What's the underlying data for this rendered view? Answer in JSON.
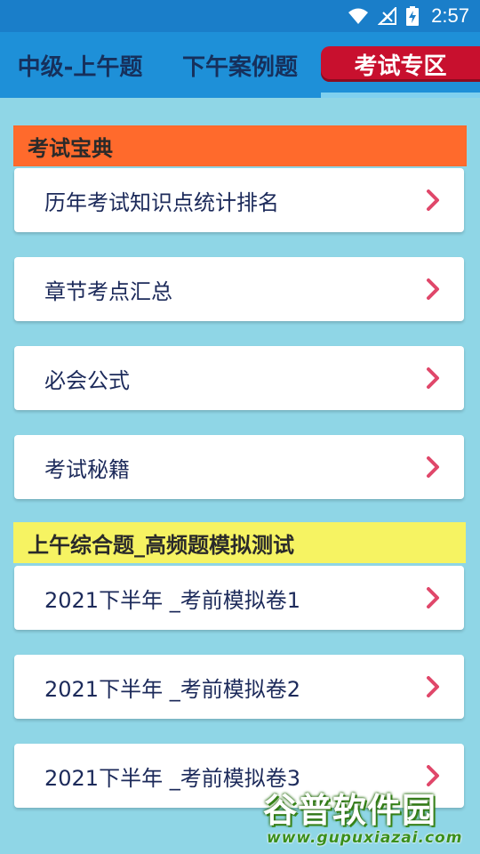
{
  "status_bar": {
    "time": "2:57",
    "icons": [
      "wifi-icon",
      "no-signal-icon",
      "battery-charging-icon"
    ]
  },
  "tabs": [
    {
      "label": "中级-上午题",
      "selected": false
    },
    {
      "label": "下午案例题",
      "selected": false
    },
    {
      "label": "考试专区",
      "selected": true
    }
  ],
  "sections": [
    {
      "title": "考试宝典",
      "color": "#ff6a2c",
      "items": [
        {
          "label": "历年考试知识点统计排名"
        },
        {
          "label": "章节考点汇总"
        },
        {
          "label": "必会公式"
        },
        {
          "label": "考试秘籍"
        }
      ]
    },
    {
      "title": "上午综合题_高频题模拟测试",
      "color": "#f6f362",
      "items": [
        {
          "label": "2021下半年 _考前模拟卷1"
        },
        {
          "label": "2021下半年 _考前模拟卷2"
        },
        {
          "label": "2021下半年 _考前模拟卷3"
        }
      ]
    }
  ],
  "watermark": {
    "title": "谷普软件园",
    "url": "www.gupuxiazai.com"
  },
  "colors": {
    "background": "#8fd6e6",
    "status_bar": "#1a7ec9",
    "tab_bar": "#1e90d8",
    "selected_tab": "#c8102e",
    "chevron": "#e0476a",
    "item_text": "#1c2a5a"
  }
}
